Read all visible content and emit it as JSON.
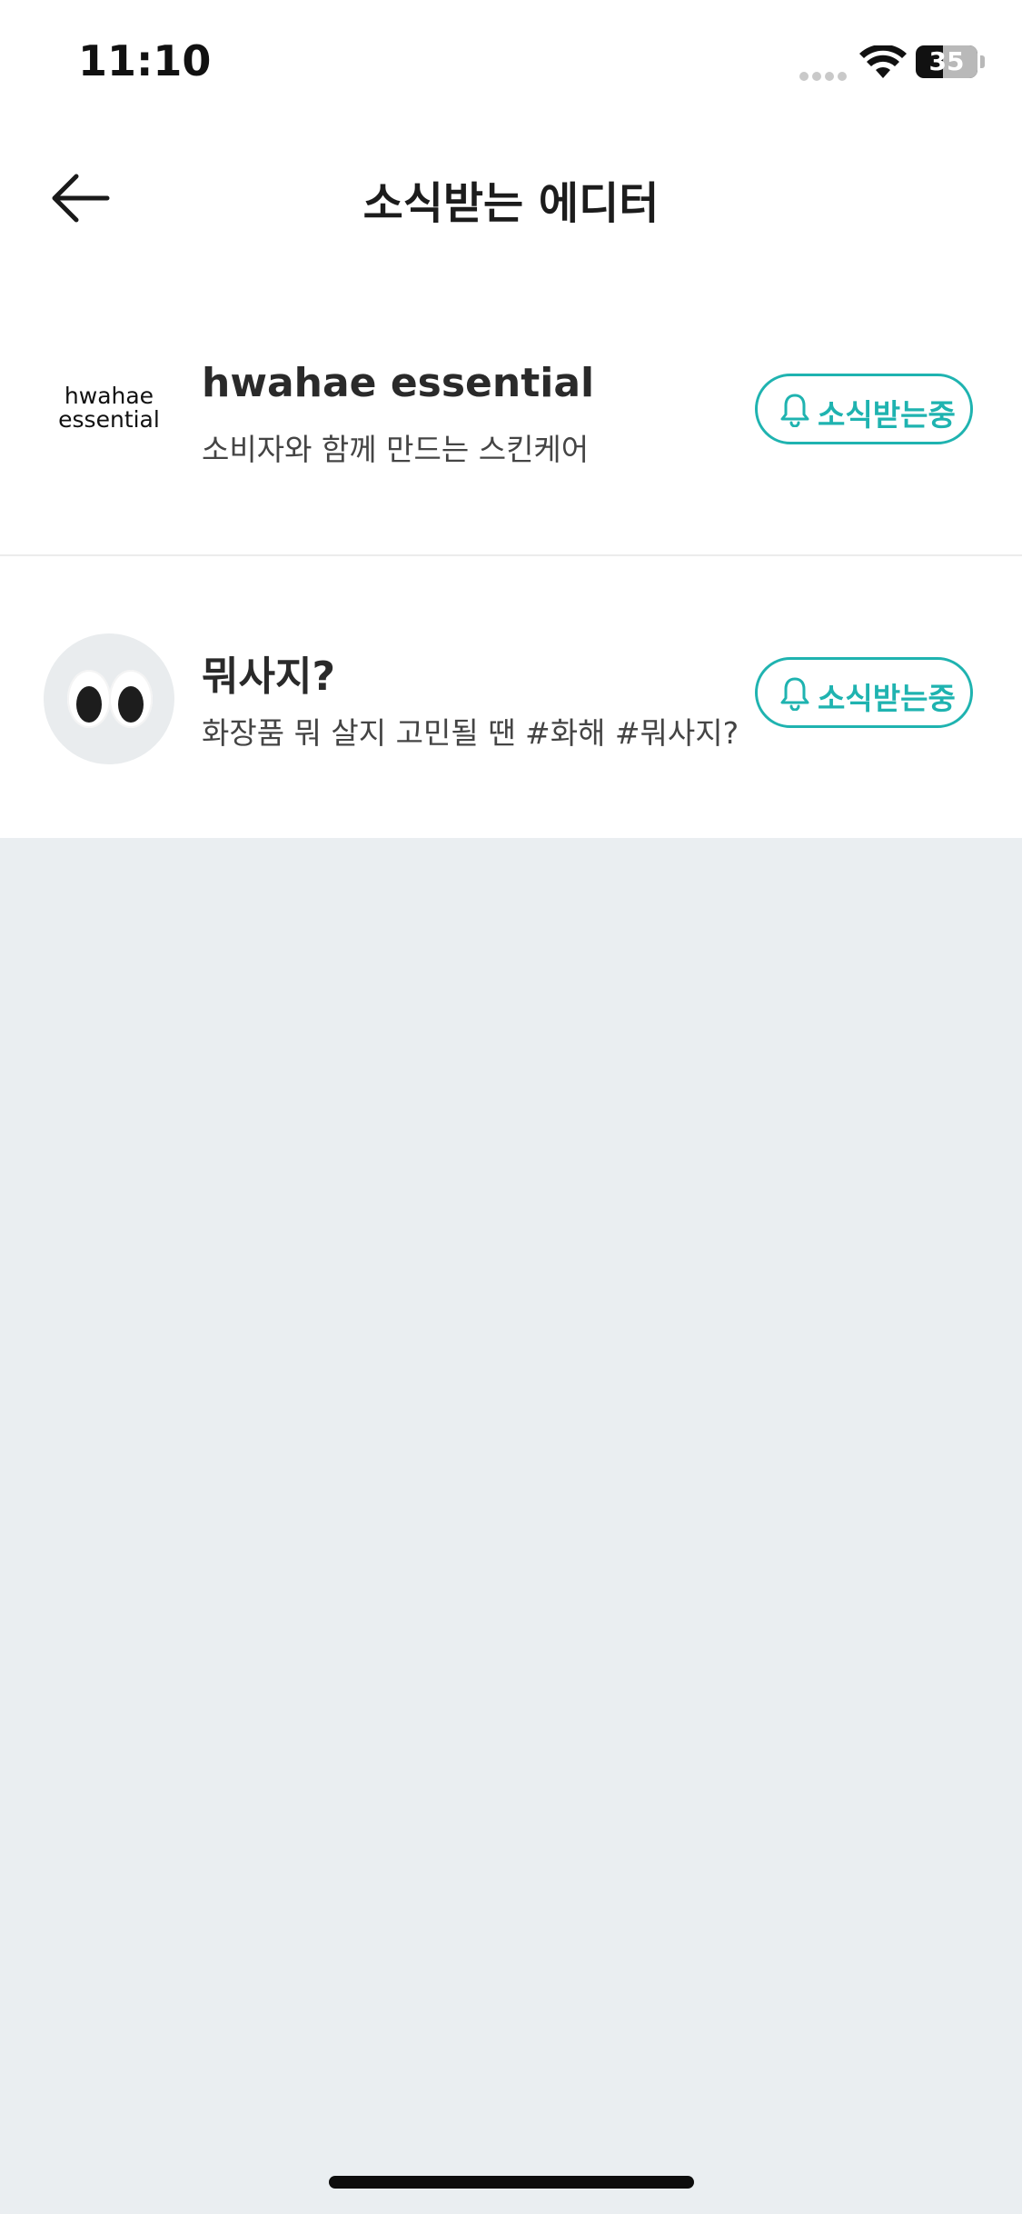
{
  "status_bar": {
    "time": "11:10",
    "battery": "35"
  },
  "header": {
    "title": "소식받는 에디터"
  },
  "editors": [
    {
      "logo_line1": "hwahae",
      "logo_line2": "essential",
      "name": "hwahae essential",
      "description": "소비자와 함께 만드는 스킨케어",
      "button_label": "소식받는중"
    },
    {
      "name": "뭐사지?",
      "description": "화장품 뭐 살지 고민될 땐 #화해 #뭐사지?",
      "button_label": "소식받는중"
    }
  ],
  "colors": {
    "accent": "#1fb3b0",
    "background": "#eaeef1"
  }
}
